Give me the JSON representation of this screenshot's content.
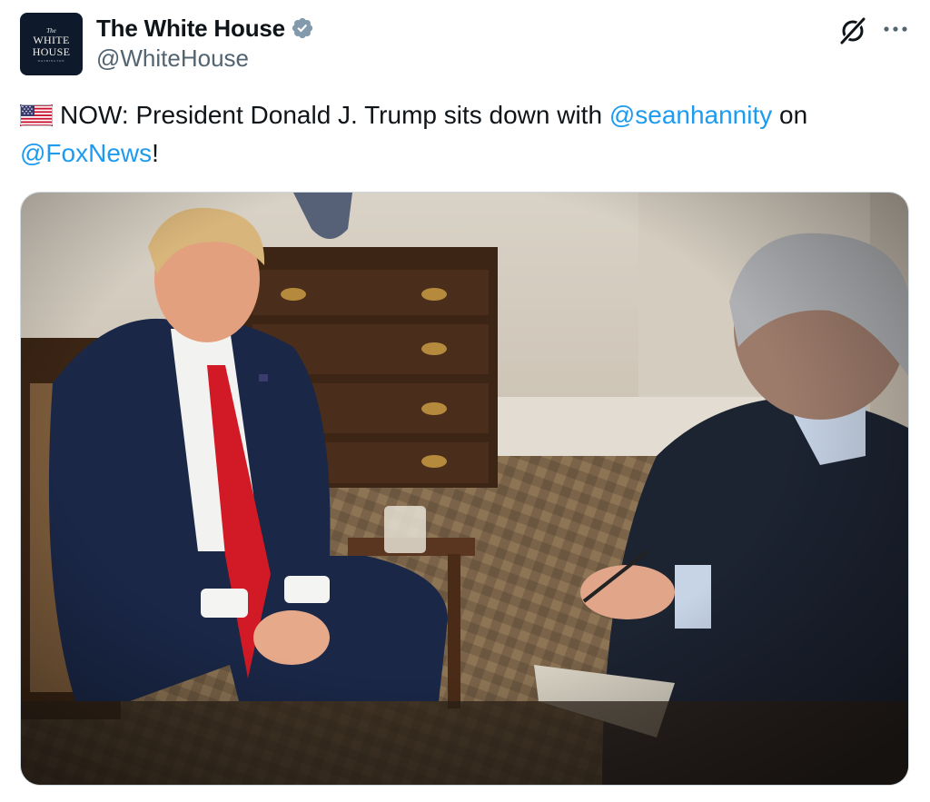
{
  "author": {
    "display_name": "The White House",
    "handle": "@WhiteHouse",
    "avatar": {
      "line1": "The",
      "line2": "WHITE",
      "line3": "HOUSE",
      "line4": "WASHINGTON"
    },
    "verified_badge_color": "#829aab"
  },
  "tweet": {
    "flag_icon": "us-flag-emoji",
    "text_lead": "NOW: President Donald J. Trump sits down with ",
    "mention_1": "@seanhannity",
    "text_mid": " on",
    "mention_2": "@FoxNews",
    "text_end": "!"
  },
  "header_actions": {
    "grok_icon": "grok-icon",
    "more_icon": "more-options-icon"
  },
  "media": {
    "kind": "photo",
    "description_icon": "interview-photo"
  },
  "colors": {
    "link": "#1d9bf0",
    "text": "#0f1419",
    "secondary": "#536471",
    "border": "#cfd9de"
  }
}
